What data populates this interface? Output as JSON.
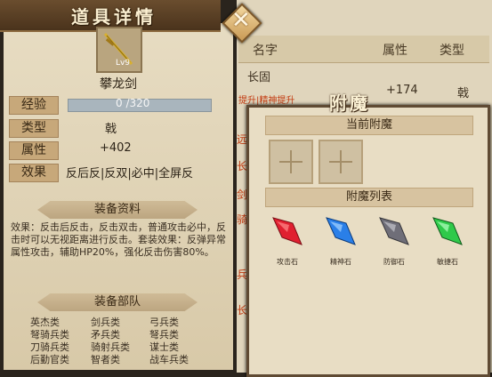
{
  "background_list": {
    "headers": [
      "名字",
      "属性",
      "类型"
    ],
    "row": {
      "name": "长固",
      "tags": "提升|精神提升",
      "value": "+174",
      "type": "戟"
    },
    "side_tabs": [
      "远",
      "长",
      "剑",
      "骑",
      "兵",
      "长"
    ]
  },
  "item_panel": {
    "title": "道具详情",
    "item_name": "攀龙剑",
    "item_level": "Lv9",
    "labels": {
      "exp": "经验",
      "type": "类型",
      "attr": "属性",
      "effect": "效果"
    },
    "exp_value": "0 /320",
    "exp_progress": 0,
    "type_value": "戟",
    "attr_value": "+402",
    "effect_value": "反后反|反双|必中|全屏反",
    "equip_info_title": "装备资料",
    "description": "效果：反击后反击，反击双击，普通攻击必中，反击时可以无视距离进行反击。套装效果：反弹异常属性攻击，辅助HP20%，强化反击伤害80%。",
    "troops_title": "装备部队",
    "troops": [
      "英杰类",
      "剑兵类",
      "弓兵类",
      "弩骑兵类",
      "矛兵类",
      "弩兵类",
      "刀骑兵类",
      "骑射兵类",
      "谋士类",
      "后勤官类",
      "智者类",
      "战车兵类"
    ]
  },
  "enchant": {
    "title": "附魔",
    "current_title": "当前附魔",
    "list_title": "附魔列表",
    "gems": [
      {
        "name": "攻击石",
        "color": "#e02030"
      },
      {
        "name": "精神石",
        "color": "#2a7fe8"
      },
      {
        "name": "防御石",
        "color": "#6f6e78"
      },
      {
        "name": "敏捷石",
        "color": "#2fc94a"
      }
    ]
  }
}
